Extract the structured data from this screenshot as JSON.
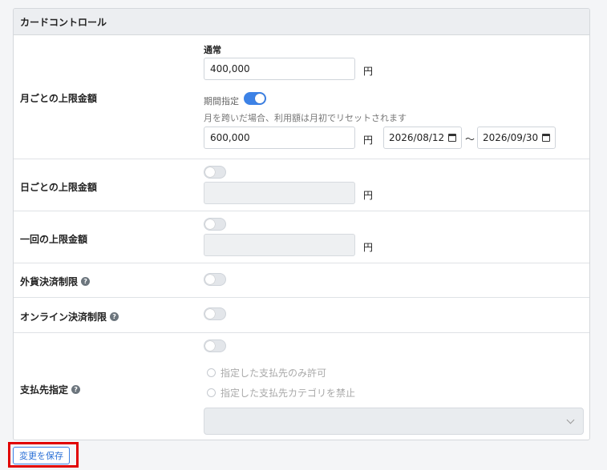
{
  "card": {
    "title": "カードコントロール"
  },
  "monthly": {
    "label": "月ごとの上限金額",
    "normal_label": "通常",
    "normal_value": "400,000",
    "unit": "円",
    "period_label": "期間指定",
    "hint": "月を跨いだ場合、利用額は月初でリセットされます",
    "period_value": "600,000",
    "date_from": "2026/08/12",
    "date_to": "2026/09/30",
    "range_sep": "～"
  },
  "daily": {
    "label": "日ごとの上限金額",
    "unit": "円"
  },
  "single": {
    "label": "一回の上限金額",
    "unit": "円"
  },
  "foreign": {
    "label": "外貨決済制限"
  },
  "online": {
    "label": "オンライン決済制限"
  },
  "payee": {
    "label": "支払先指定",
    "options": [
      "指定した支払先のみ許可",
      "指定した支払先カテゴリを禁止"
    ]
  },
  "actions": {
    "save_label": "変更を保存"
  },
  "icons": {
    "help": "?"
  },
  "colors": {
    "accent": "#3d82e6",
    "highlight": "#e10000"
  }
}
